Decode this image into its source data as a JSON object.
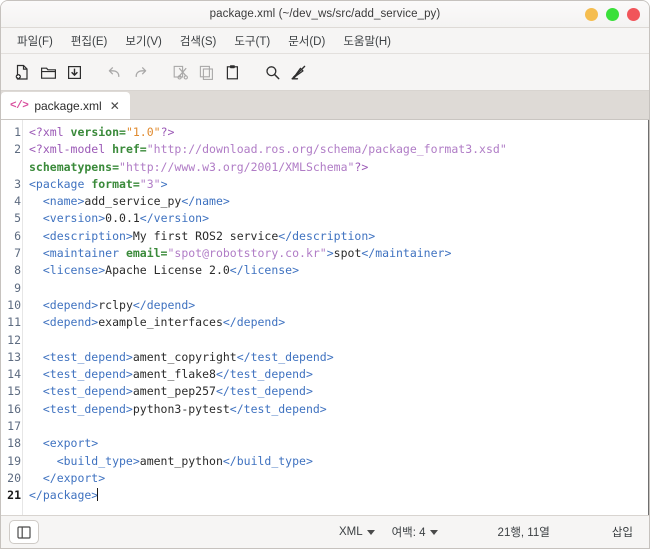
{
  "window": {
    "title": "package.xml (~/dev_ws/src/add_service_py)",
    "controls": [
      {
        "name": "minimize",
        "color": "#f5bd4f"
      },
      {
        "name": "maximize",
        "color": "#3ae03a"
      },
      {
        "name": "close",
        "color": "#f1555a"
      }
    ]
  },
  "menubar": {
    "items": [
      {
        "label": "파일(F)"
      },
      {
        "label": "편집(E)"
      },
      {
        "label": "보기(V)"
      },
      {
        "label": "검색(S)"
      },
      {
        "label": "도구(T)"
      },
      {
        "label": "문서(D)"
      },
      {
        "label": "도움말(H)"
      }
    ]
  },
  "toolbar": {
    "buttons": [
      {
        "name": "new-file-icon",
        "enabled": true
      },
      {
        "name": "open-folder-icon",
        "enabled": true
      },
      {
        "name": "save-file-icon",
        "enabled": true
      },
      {
        "name": "undo-icon",
        "enabled": false
      },
      {
        "name": "redo-icon",
        "enabled": false
      },
      {
        "name": "cut-icon",
        "enabled": false
      },
      {
        "name": "copy-icon",
        "enabled": false
      },
      {
        "name": "paste-icon",
        "enabled": true
      },
      {
        "name": "search-icon",
        "enabled": true
      },
      {
        "name": "clear-highlight-icon",
        "enabled": true
      }
    ]
  },
  "tabs": [
    {
      "icon": "</>",
      "label": "package.xml",
      "close": "✕",
      "active": true
    }
  ],
  "editor": {
    "language": "XML",
    "gutter": [
      "1",
      "2",
      "",
      "3",
      "4",
      "5",
      "6",
      "7",
      "8",
      "9",
      "10",
      "11",
      "12",
      "13",
      "14",
      "15",
      "16",
      "17",
      "18",
      "19",
      "20",
      "21"
    ],
    "current_line": 21,
    "lines": [
      {
        "n": "1",
        "tokens": [
          {
            "t": "<?xml ",
            "c": "s-pi"
          },
          {
            "t": "version=",
            "c": "s-attr"
          },
          {
            "t": "\"1.0\"",
            "c": "s-str-o"
          },
          {
            "t": "?>",
            "c": "s-pi"
          }
        ]
      },
      {
        "n": "2",
        "tokens": [
          {
            "t": "<?xml-model ",
            "c": "s-pi"
          },
          {
            "t": "href=",
            "c": "s-attr"
          },
          {
            "t": "\"http://download.ros.org/schema/package_format3.xsd\"",
            "c": "s-str-p"
          }
        ]
      },
      {
        "n": "",
        "tokens": [
          {
            "t": "schematypens=",
            "c": "s-attr"
          },
          {
            "t": "\"http://www.w3.org/2001/XMLSchema\"",
            "c": "s-str-p"
          },
          {
            "t": "?>",
            "c": "s-pi"
          }
        ]
      },
      {
        "n": "3",
        "tokens": [
          {
            "t": "<package ",
            "c": "s-tag"
          },
          {
            "t": "format=",
            "c": "s-attr"
          },
          {
            "t": "\"3\"",
            "c": "s-str-p"
          },
          {
            "t": ">",
            "c": "s-tag"
          }
        ]
      },
      {
        "n": "4",
        "tokens": [
          {
            "t": "  <name>",
            "c": "s-tag"
          },
          {
            "t": "add_service_py",
            "c": "s-txt"
          },
          {
            "t": "</name>",
            "c": "s-tag"
          }
        ]
      },
      {
        "n": "5",
        "tokens": [
          {
            "t": "  <version>",
            "c": "s-tag"
          },
          {
            "t": "0.0.1",
            "c": "s-txt"
          },
          {
            "t": "</version>",
            "c": "s-tag"
          }
        ]
      },
      {
        "n": "6",
        "tokens": [
          {
            "t": "  <description>",
            "c": "s-tag"
          },
          {
            "t": "My first ROS2 service",
            "c": "s-txt"
          },
          {
            "t": "</description>",
            "c": "s-tag"
          }
        ]
      },
      {
        "n": "7",
        "tokens": [
          {
            "t": "  <maintainer ",
            "c": "s-tag"
          },
          {
            "t": "email=",
            "c": "s-attr"
          },
          {
            "t": "\"spot@robotstory.co.kr\"",
            "c": "s-str-p"
          },
          {
            "t": ">",
            "c": "s-tag"
          },
          {
            "t": "spot",
            "c": "s-txt"
          },
          {
            "t": "</maintainer>",
            "c": "s-tag"
          }
        ]
      },
      {
        "n": "8",
        "tokens": [
          {
            "t": "  <license>",
            "c": "s-tag"
          },
          {
            "t": "Apache License 2.0",
            "c": "s-txt"
          },
          {
            "t": "</license>",
            "c": "s-tag"
          }
        ]
      },
      {
        "n": "9",
        "tokens": []
      },
      {
        "n": "10",
        "tokens": [
          {
            "t": "  <depend>",
            "c": "s-tag"
          },
          {
            "t": "rclpy",
            "c": "s-txt"
          },
          {
            "t": "</depend>",
            "c": "s-tag"
          }
        ]
      },
      {
        "n": "11",
        "tokens": [
          {
            "t": "  <depend>",
            "c": "s-tag"
          },
          {
            "t": "example_interfaces",
            "c": "s-txt"
          },
          {
            "t": "</depend>",
            "c": "s-tag"
          }
        ]
      },
      {
        "n": "12",
        "tokens": []
      },
      {
        "n": "13",
        "tokens": [
          {
            "t": "  <test_depend>",
            "c": "s-tag"
          },
          {
            "t": "ament_copyright",
            "c": "s-txt"
          },
          {
            "t": "</test_depend>",
            "c": "s-tag"
          }
        ]
      },
      {
        "n": "14",
        "tokens": [
          {
            "t": "  <test_depend>",
            "c": "s-tag"
          },
          {
            "t": "ament_flake8",
            "c": "s-txt"
          },
          {
            "t": "</test_depend>",
            "c": "s-tag"
          }
        ]
      },
      {
        "n": "15",
        "tokens": [
          {
            "t": "  <test_depend>",
            "c": "s-tag"
          },
          {
            "t": "ament_pep257",
            "c": "s-txt"
          },
          {
            "t": "</test_depend>",
            "c": "s-tag"
          }
        ]
      },
      {
        "n": "16",
        "tokens": [
          {
            "t": "  <test_depend>",
            "c": "s-tag"
          },
          {
            "t": "python3-pytest",
            "c": "s-txt"
          },
          {
            "t": "</test_depend>",
            "c": "s-tag"
          }
        ]
      },
      {
        "n": "17",
        "tokens": []
      },
      {
        "n": "18",
        "tokens": [
          {
            "t": "  <export>",
            "c": "s-tag"
          }
        ]
      },
      {
        "n": "19",
        "tokens": [
          {
            "t": "    <build_type>",
            "c": "s-tag"
          },
          {
            "t": "ament_python",
            "c": "s-txt"
          },
          {
            "t": "</build_type>",
            "c": "s-tag"
          }
        ]
      },
      {
        "n": "20",
        "tokens": [
          {
            "t": "  </export>",
            "c": "s-tag"
          }
        ]
      },
      {
        "n": "21",
        "tokens": [
          {
            "t": "</package>",
            "c": "s-tag"
          }
        ],
        "caret": true
      }
    ]
  },
  "statusbar": {
    "toggle_icon": "sidebar-toggle-icon",
    "language": "XML",
    "indent": "여백: 4",
    "position": "21행, 11열",
    "insert_mode": "삽입"
  }
}
